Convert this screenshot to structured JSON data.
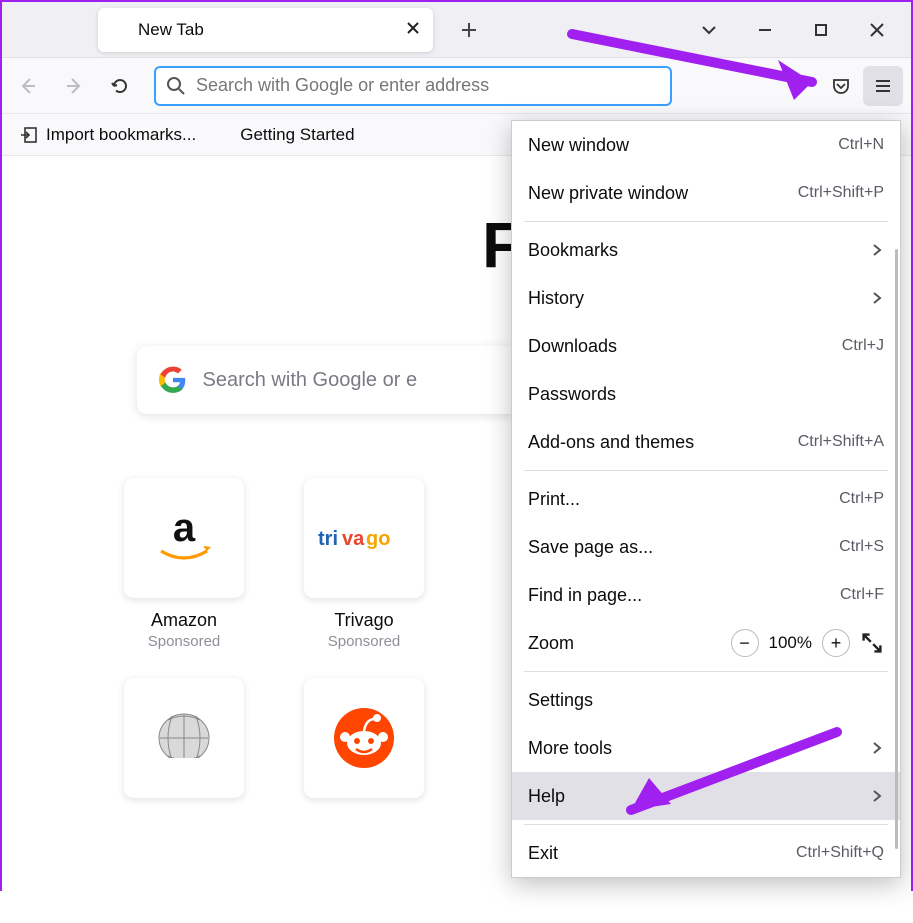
{
  "tab": {
    "title": "New Tab"
  },
  "urlbar": {
    "placeholder": "Search with Google or enter address"
  },
  "bookmarks": {
    "import": "Import bookmarks...",
    "getting_started": "Getting Started"
  },
  "hero": {
    "text": "Fir"
  },
  "searchbox": {
    "placeholder": "Search with Google or e"
  },
  "tiles": [
    {
      "title": "Amazon",
      "sub": "Sponsored"
    },
    {
      "title": "Trivago",
      "sub": "Sponsored"
    }
  ],
  "menu": {
    "new_window": {
      "label": "New window",
      "key": "Ctrl+N"
    },
    "new_private": {
      "label": "New private window",
      "key": "Ctrl+Shift+P"
    },
    "bookmarks": {
      "label": "Bookmarks"
    },
    "history": {
      "label": "History"
    },
    "downloads": {
      "label": "Downloads",
      "key": "Ctrl+J"
    },
    "passwords": {
      "label": "Passwords"
    },
    "addons": {
      "label": "Add-ons and themes",
      "key": "Ctrl+Shift+A"
    },
    "print": {
      "label": "Print...",
      "key": "Ctrl+P"
    },
    "save_as": {
      "label": "Save page as...",
      "key": "Ctrl+S"
    },
    "find": {
      "label": "Find in page...",
      "key": "Ctrl+F"
    },
    "zoom": {
      "label": "Zoom",
      "pct": "100%"
    },
    "settings": {
      "label": "Settings"
    },
    "more_tools": {
      "label": "More tools"
    },
    "help": {
      "label": "Help"
    },
    "exit": {
      "label": "Exit",
      "key": "Ctrl+Shift+Q"
    }
  },
  "colors": {
    "accent_arrow": "#a020f0"
  }
}
